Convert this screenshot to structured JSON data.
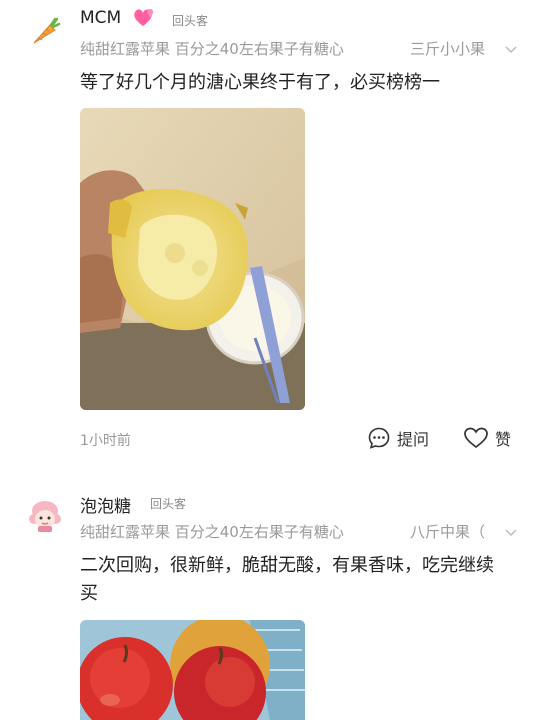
{
  "reviews": [
    {
      "username": "MCM",
      "emoji": "💞",
      "badge": "回头客",
      "spec_name": "纯甜红露苹果 百分之40左右果子有糖心",
      "spec_variant": "三斤小小果",
      "text": "等了好几个月的溏心果终于有了，必买榜榜一",
      "time": "1小时前",
      "ask_label": "提问",
      "like_label": "赞"
    },
    {
      "username": "泡泡糖",
      "badge": "回头客",
      "spec_name": "纯甜红露苹果 百分之40左右果子有糖心",
      "spec_variant": "八斤中果（",
      "text": "二次回购，很新鲜，脆甜无酸，有果香味，吃完继续买"
    }
  ],
  "icons": [
    "carrot-avatar-icon",
    "heart-emoji-icon",
    "chevron-down-icon",
    "question-bubble-icon",
    "heart-outline-icon",
    "girl-avatar-icon"
  ],
  "colors": {
    "text": "#222222",
    "muted": "#9a9a9a",
    "badge": "#888888"
  }
}
